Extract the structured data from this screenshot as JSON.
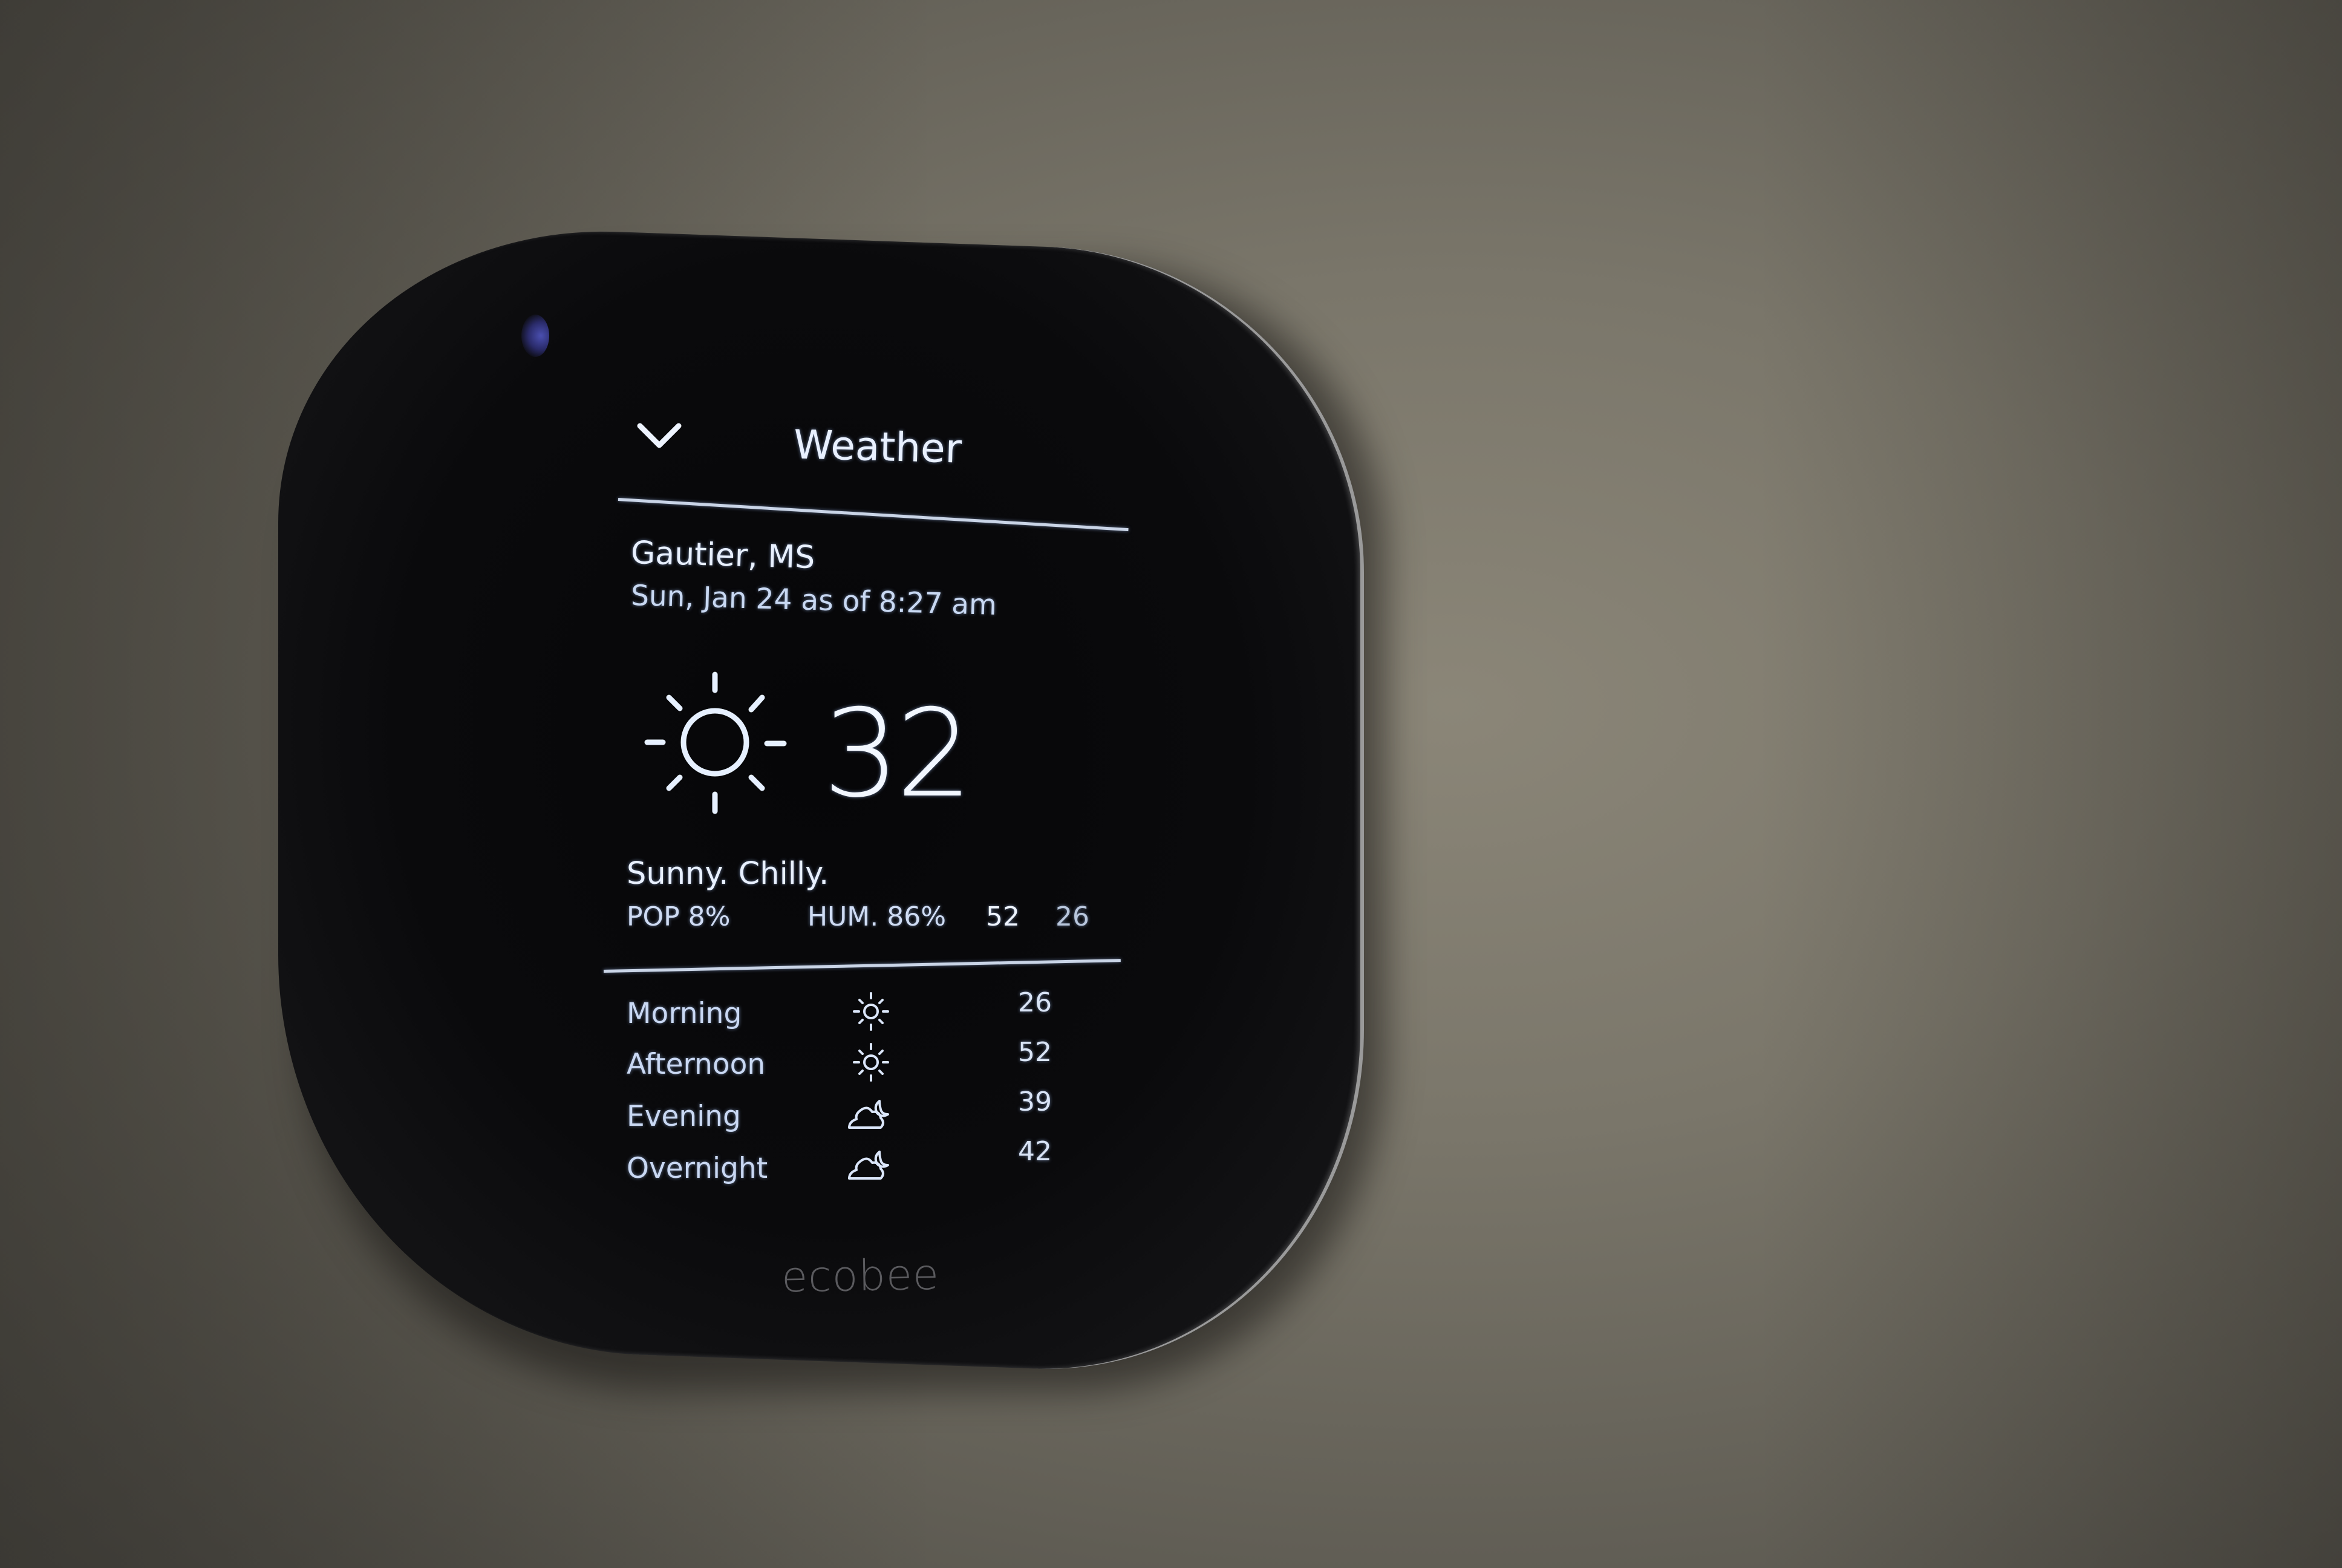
{
  "device": {
    "brand": "ecobee",
    "sensor_color": "#4a4fb0"
  },
  "screen": {
    "header": {
      "back_icon": "chevron-down-icon",
      "title": "Weather"
    },
    "location": "Gautier, MS",
    "updated": "Sun, Jan 24 as of 8:27 am",
    "current": {
      "icon": "sun-icon",
      "temperature": "32",
      "condition": "Sunny. Chilly.",
      "pop": "POP 8%",
      "humidity": "HUM. 86%",
      "high": "52",
      "low": "26"
    },
    "forecast": [
      {
        "period": "Morning",
        "icon": "sun-icon",
        "temp": "26"
      },
      {
        "period": "Afternoon",
        "icon": "sun-icon",
        "temp": "52"
      },
      {
        "period": "Evening",
        "icon": "cloud-moon-icon",
        "temp": "39"
      },
      {
        "period": "Overnight",
        "icon": "cloud-moon-icon",
        "temp": "42"
      }
    ]
  },
  "colors": {
    "screen_text": "#e8f0ff",
    "device_body": "#0a0a0c",
    "wall": "#7a766a"
  }
}
